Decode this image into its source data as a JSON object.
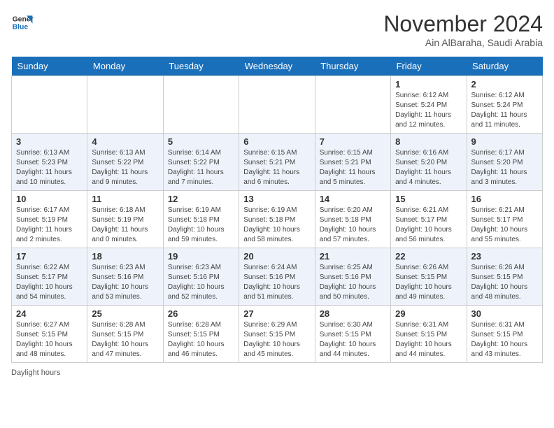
{
  "logo": {
    "line1": "General",
    "line2": "Blue"
  },
  "title": "November 2024",
  "location": "Ain AlBaraha, Saudi Arabia",
  "days_of_week": [
    "Sunday",
    "Monday",
    "Tuesday",
    "Wednesday",
    "Thursday",
    "Friday",
    "Saturday"
  ],
  "footer": "Daylight hours",
  "weeks": [
    [
      {
        "day": "",
        "info": ""
      },
      {
        "day": "",
        "info": ""
      },
      {
        "day": "",
        "info": ""
      },
      {
        "day": "",
        "info": ""
      },
      {
        "day": "",
        "info": ""
      },
      {
        "day": "1",
        "info": "Sunrise: 6:12 AM\nSunset: 5:24 PM\nDaylight: 11 hours and 12 minutes."
      },
      {
        "day": "2",
        "info": "Sunrise: 6:12 AM\nSunset: 5:24 PM\nDaylight: 11 hours and 11 minutes."
      }
    ],
    [
      {
        "day": "3",
        "info": "Sunrise: 6:13 AM\nSunset: 5:23 PM\nDaylight: 11 hours and 10 minutes."
      },
      {
        "day": "4",
        "info": "Sunrise: 6:13 AM\nSunset: 5:22 PM\nDaylight: 11 hours and 9 minutes."
      },
      {
        "day": "5",
        "info": "Sunrise: 6:14 AM\nSunset: 5:22 PM\nDaylight: 11 hours and 7 minutes."
      },
      {
        "day": "6",
        "info": "Sunrise: 6:15 AM\nSunset: 5:21 PM\nDaylight: 11 hours and 6 minutes."
      },
      {
        "day": "7",
        "info": "Sunrise: 6:15 AM\nSunset: 5:21 PM\nDaylight: 11 hours and 5 minutes."
      },
      {
        "day": "8",
        "info": "Sunrise: 6:16 AM\nSunset: 5:20 PM\nDaylight: 11 hours and 4 minutes."
      },
      {
        "day": "9",
        "info": "Sunrise: 6:17 AM\nSunset: 5:20 PM\nDaylight: 11 hours and 3 minutes."
      }
    ],
    [
      {
        "day": "10",
        "info": "Sunrise: 6:17 AM\nSunset: 5:19 PM\nDaylight: 11 hours and 2 minutes."
      },
      {
        "day": "11",
        "info": "Sunrise: 6:18 AM\nSunset: 5:19 PM\nDaylight: 11 hours and 0 minutes."
      },
      {
        "day": "12",
        "info": "Sunrise: 6:19 AM\nSunset: 5:18 PM\nDaylight: 10 hours and 59 minutes."
      },
      {
        "day": "13",
        "info": "Sunrise: 6:19 AM\nSunset: 5:18 PM\nDaylight: 10 hours and 58 minutes."
      },
      {
        "day": "14",
        "info": "Sunrise: 6:20 AM\nSunset: 5:18 PM\nDaylight: 10 hours and 57 minutes."
      },
      {
        "day": "15",
        "info": "Sunrise: 6:21 AM\nSunset: 5:17 PM\nDaylight: 10 hours and 56 minutes."
      },
      {
        "day": "16",
        "info": "Sunrise: 6:21 AM\nSunset: 5:17 PM\nDaylight: 10 hours and 55 minutes."
      }
    ],
    [
      {
        "day": "17",
        "info": "Sunrise: 6:22 AM\nSunset: 5:17 PM\nDaylight: 10 hours and 54 minutes."
      },
      {
        "day": "18",
        "info": "Sunrise: 6:23 AM\nSunset: 5:16 PM\nDaylight: 10 hours and 53 minutes."
      },
      {
        "day": "19",
        "info": "Sunrise: 6:23 AM\nSunset: 5:16 PM\nDaylight: 10 hours and 52 minutes."
      },
      {
        "day": "20",
        "info": "Sunrise: 6:24 AM\nSunset: 5:16 PM\nDaylight: 10 hours and 51 minutes."
      },
      {
        "day": "21",
        "info": "Sunrise: 6:25 AM\nSunset: 5:16 PM\nDaylight: 10 hours and 50 minutes."
      },
      {
        "day": "22",
        "info": "Sunrise: 6:26 AM\nSunset: 5:15 PM\nDaylight: 10 hours and 49 minutes."
      },
      {
        "day": "23",
        "info": "Sunrise: 6:26 AM\nSunset: 5:15 PM\nDaylight: 10 hours and 48 minutes."
      }
    ],
    [
      {
        "day": "24",
        "info": "Sunrise: 6:27 AM\nSunset: 5:15 PM\nDaylight: 10 hours and 48 minutes."
      },
      {
        "day": "25",
        "info": "Sunrise: 6:28 AM\nSunset: 5:15 PM\nDaylight: 10 hours and 47 minutes."
      },
      {
        "day": "26",
        "info": "Sunrise: 6:28 AM\nSunset: 5:15 PM\nDaylight: 10 hours and 46 minutes."
      },
      {
        "day": "27",
        "info": "Sunrise: 6:29 AM\nSunset: 5:15 PM\nDaylight: 10 hours and 45 minutes."
      },
      {
        "day": "28",
        "info": "Sunrise: 6:30 AM\nSunset: 5:15 PM\nDaylight: 10 hours and 44 minutes."
      },
      {
        "day": "29",
        "info": "Sunrise: 6:31 AM\nSunset: 5:15 PM\nDaylight: 10 hours and 44 minutes."
      },
      {
        "day": "30",
        "info": "Sunrise: 6:31 AM\nSunset: 5:15 PM\nDaylight: 10 hours and 43 minutes."
      }
    ]
  ]
}
